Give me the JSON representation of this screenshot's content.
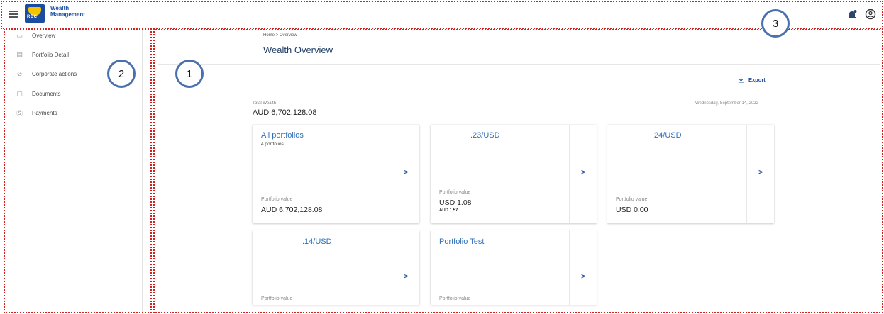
{
  "header": {
    "brand_line1": "Wealth",
    "brand_line2": "Management",
    "logo_text": "RBC"
  },
  "sidebar": {
    "items": [
      {
        "label": "Overview",
        "icon": "overview-icon"
      },
      {
        "label": "Portfolio Detail",
        "icon": "portfolio-detail-icon"
      },
      {
        "label": "Corporate actions",
        "icon": "corporate-actions-icon"
      },
      {
        "label": "Documents",
        "icon": "documents-icon"
      },
      {
        "label": "Payments",
        "icon": "payments-icon"
      }
    ]
  },
  "main": {
    "breadcrumb": "Home  >  Overview",
    "title": "Wealth Overview",
    "export_label": "Export",
    "total_wealth_label": "Total Wealth",
    "total_wealth_value": "AUD 6,702,128.08",
    "date": "Wednesday, September 14, 2022"
  },
  "cards": [
    {
      "title": "All portfolios",
      "subtitle": "4 portfolios",
      "pv_label": "Portfolio value",
      "pv_value": "AUD 6,702,128.08",
      "pv_sub": ""
    },
    {
      "title": ".23/USD",
      "subtitle": "",
      "pv_label": "Portfolio value",
      "pv_value": "USD 1.08",
      "pv_sub": "AUD 1.57"
    },
    {
      "title": ".24/USD",
      "subtitle": "",
      "pv_label": "Portfolio value",
      "pv_value": "USD 0.00",
      "pv_sub": ""
    },
    {
      "title": ".14/USD",
      "subtitle": "",
      "pv_label": "Portfolio value",
      "pv_value": "",
      "pv_sub": ""
    },
    {
      "title": "Portfolio Test",
      "subtitle": "",
      "pv_label": "Portfolio value",
      "pv_value": "",
      "pv_sub": ""
    }
  ],
  "chevron": ">",
  "annotations": [
    "1",
    "2",
    "3"
  ],
  "colors": {
    "accent": "#1a4da1",
    "card_title": "#2f6fb6",
    "annotation_border": "#d32020",
    "badge_ring": "#4a70ae"
  }
}
